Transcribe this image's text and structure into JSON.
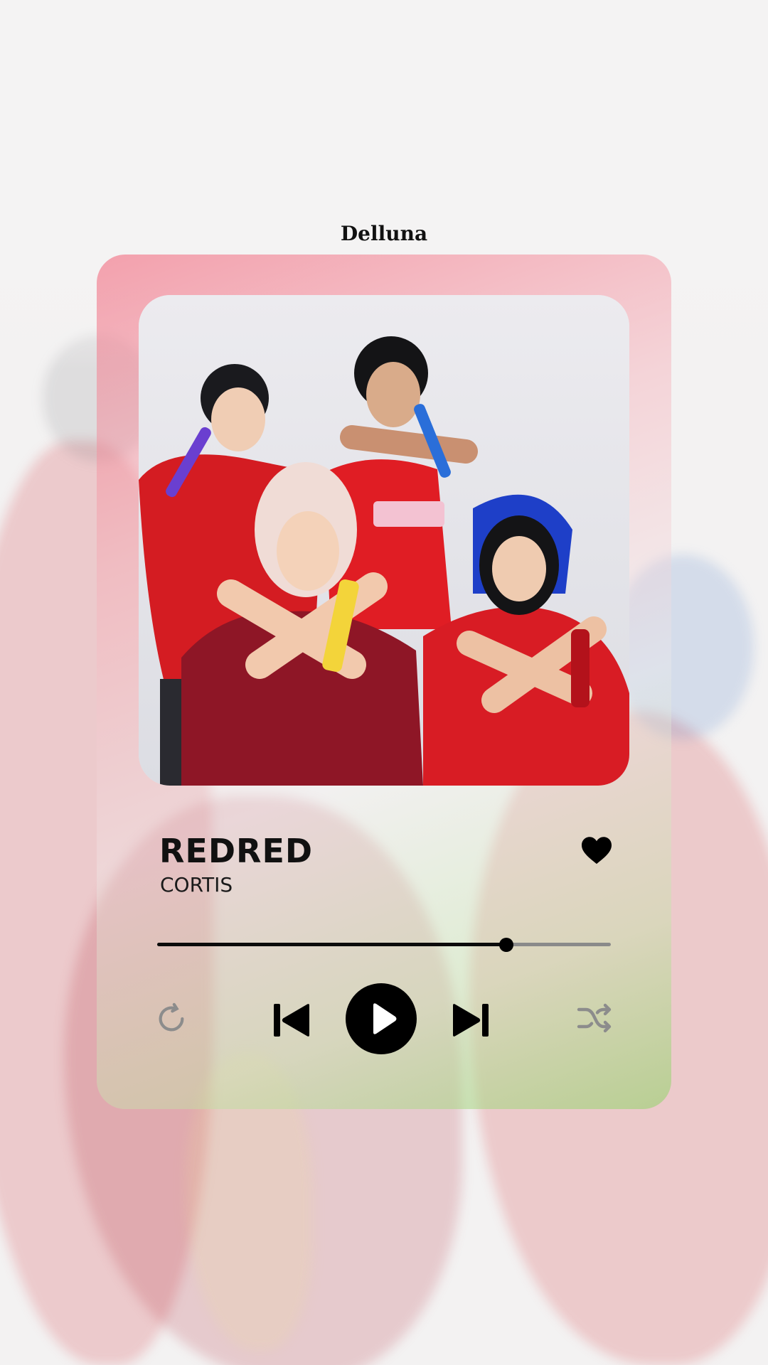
{
  "app": {
    "brand": "Delluna"
  },
  "track": {
    "title": "REDRED",
    "artist": "CORTIS",
    "progress": 0.77,
    "liked": true
  },
  "controls": {
    "repeat_icon": "repeat-icon",
    "previous_icon": "skip-previous-icon",
    "play_icon": "play-icon",
    "next_icon": "skip-next-icon",
    "shuffle_icon": "shuffle-icon",
    "heart_icon": "heart-icon"
  },
  "colors": {
    "card_pink": "#f26e82",
    "card_green": "#96d26e",
    "primary": "#000000",
    "track_inactive": "#8a8a8a",
    "muted_icon": "#8c8c8c"
  }
}
